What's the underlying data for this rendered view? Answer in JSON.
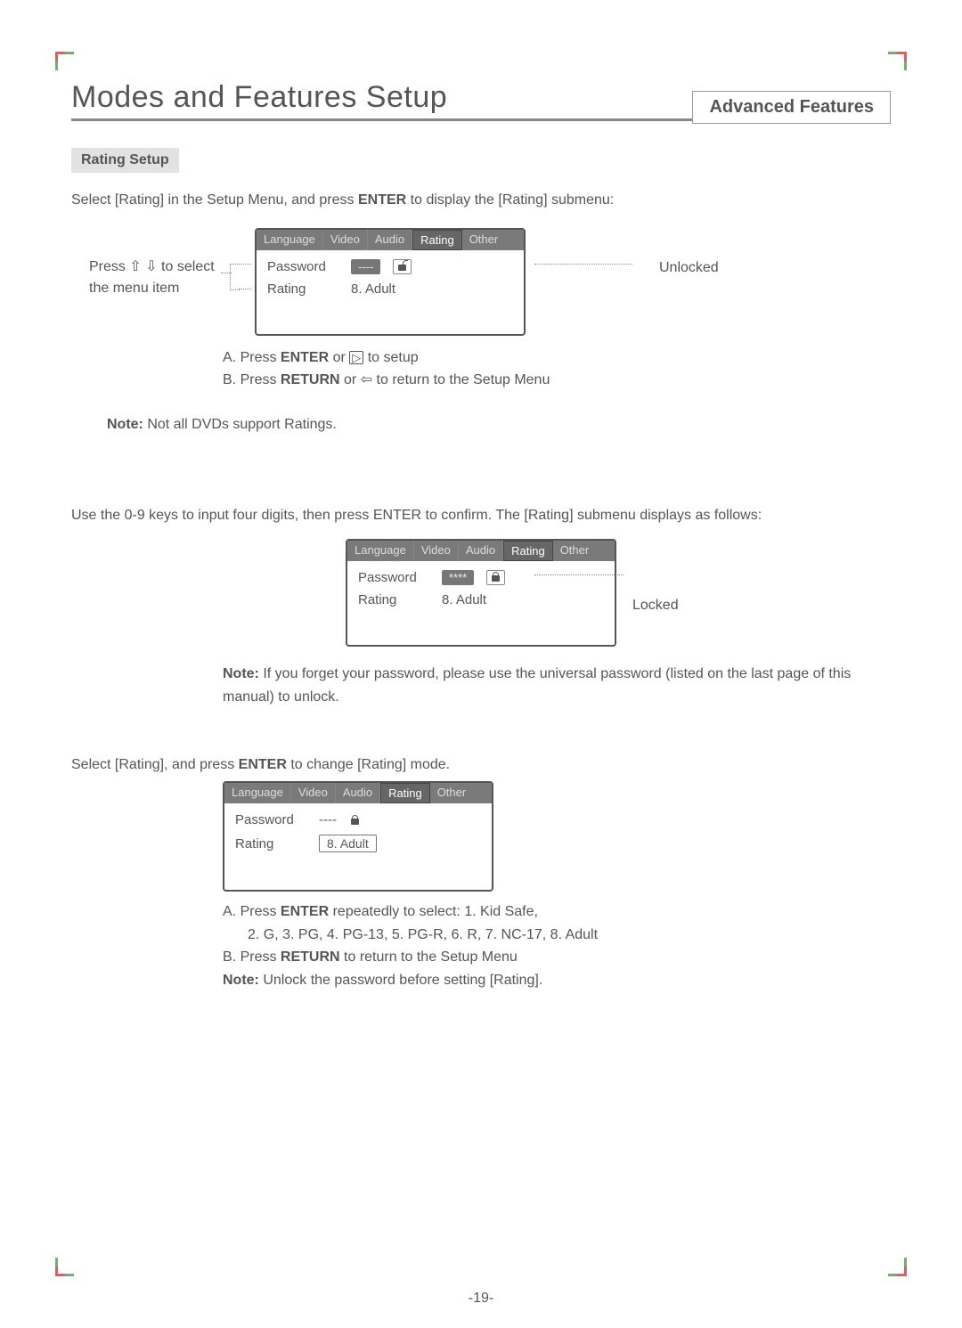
{
  "header": {
    "title": "Modes and Features Setup",
    "advanced": "Advanced Features"
  },
  "section": {
    "label": "Rating Setup",
    "intro_pre": "Select [Rating] in the Setup Menu, and press ",
    "intro_bold": "ENTER",
    "intro_post": " to display the [Rating] submenu:"
  },
  "hint_left": "Press ⇧ ⇩ to select the menu item",
  "tabs": {
    "language": "Language",
    "video": "Video",
    "audio": "Audio",
    "rating": "Rating",
    "other": "Other"
  },
  "menu1": {
    "password_label": "Password",
    "password_value": "----",
    "rating_label": "Rating",
    "rating_value": "8. Adult",
    "status": "Unlocked"
  },
  "steps1": {
    "a_pre": "A.  Press ",
    "a_bold": "ENTER",
    "a_post": " or ",
    "a_tail": " to setup",
    "b_pre": "B.  Press ",
    "b_bold": "RETURN",
    "b_post": " or ",
    "b_tail": " to return to the Setup Menu"
  },
  "note1_label": "Note:",
  "note1_text": " Not all DVDs support Ratings.",
  "para2": "Use the 0-9 keys to input four digits, then press ENTER to confirm. The [Rating] submenu displays as follows:",
  "menu2": {
    "password_label": "Password",
    "password_value": "****",
    "rating_label": "Rating",
    "rating_value": "8. Adult",
    "status": "Locked"
  },
  "note2_label": "Note:",
  "note2_text": " If you forget your password, please use the universal password (listed on the last page of this manual) to unlock.",
  "para3_pre": "Select [Rating], and press ",
  "para3_bold": "ENTER",
  "para3_post": " to change [Rating] mode.",
  "menu3": {
    "password_label": "Password",
    "password_value": "----",
    "rating_label": "Rating",
    "rating_value": "8. Adult"
  },
  "steps3": {
    "a_pre": "A.  Press ",
    "a_bold": "ENTER",
    "a_post": " repeatedly to select: 1. Kid Safe,",
    "a_line2": "2.  G, 3. PG, 4. PG-13, 5. PG-R, 6. R, 7. NC-17, 8. Adult",
    "b_pre": "B.  Press ",
    "b_bold": "RETURN",
    "b_post": " to return to the Setup Menu",
    "note_label": "Note:",
    "note_text": " Unlock the password before setting [Rating]."
  },
  "page_number": "-19-"
}
